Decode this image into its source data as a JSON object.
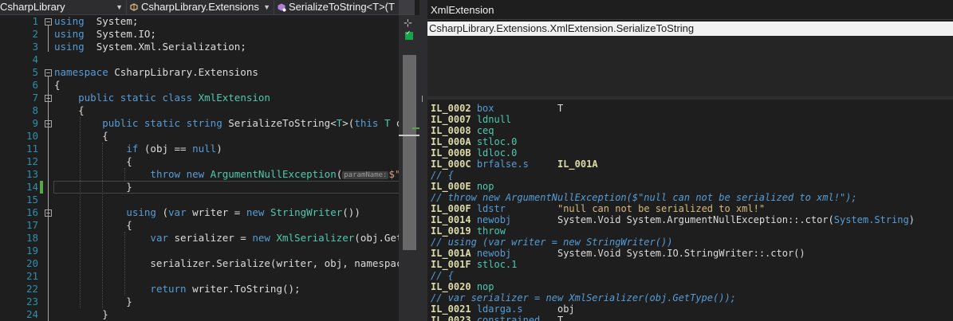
{
  "nav": {
    "project": "CsharpLibrary",
    "type": "CsharpLibrary.Extensions",
    "member": "SerializeToString<T>(T o"
  },
  "editor": {
    "line_numbers": [
      "1",
      "2",
      "3",
      "4",
      "5",
      "6",
      "7",
      "8",
      "9",
      "10",
      "11",
      "12",
      "13",
      "14",
      "15",
      "16",
      "17",
      "18",
      "19",
      "20",
      "21",
      "22",
      "23",
      "24"
    ],
    "lines": [
      [
        [
          "kw",
          "using"
        ],
        [
          "",
          "  System;"
        ]
      ],
      [
        [
          "kw",
          "using"
        ],
        [
          "",
          "  System.IO;"
        ]
      ],
      [
        [
          "kw",
          "using"
        ],
        [
          "",
          "  System.Xml.Serialization;"
        ]
      ],
      [],
      [
        [
          "kw",
          "namespace"
        ],
        [
          "",
          " CsharpLibrary.Extensions"
        ]
      ],
      [
        [
          "",
          "{"
        ]
      ],
      [
        [
          "",
          "    "
        ],
        [
          "kw",
          "public static class"
        ],
        [
          "",
          ""
        ],
        [
          "ty",
          " XmlExtension"
        ]
      ],
      [
        [
          "",
          "    {"
        ]
      ],
      [
        [
          "",
          "        "
        ],
        [
          "kw",
          "public static string"
        ],
        [
          "",
          " SerializeToString<"
        ],
        [
          "ty",
          "T"
        ],
        [
          "",
          ">("
        ],
        [
          "kw",
          "this"
        ],
        [
          "ty",
          " T"
        ],
        [
          "",
          " obj,"
        ]
      ],
      [
        [
          "",
          "        {"
        ]
      ],
      [
        [
          "",
          "            "
        ],
        [
          "kw",
          "if"
        ],
        [
          "",
          " (obj == "
        ],
        [
          "kw",
          "null"
        ],
        [
          "",
          ")"
        ]
      ],
      [
        [
          "",
          "            {"
        ]
      ],
      [
        [
          "",
          "                "
        ],
        [
          "kw",
          "throw new"
        ],
        [
          "ty",
          " ArgumentNullException"
        ],
        [
          "",
          "("
        ],
        [
          "hint",
          "paramName:"
        ],
        [
          "st",
          "$\"null"
        ]
      ],
      [
        [
          "",
          "            }"
        ]
      ],
      [],
      [
        [
          "",
          "            "
        ],
        [
          "kw",
          "using"
        ],
        [
          "",
          " ("
        ],
        [
          "kw",
          "var"
        ],
        [
          "",
          " writer = "
        ],
        [
          "kw",
          "new"
        ],
        [
          "ty",
          " StringWriter"
        ],
        [
          "",
          "()"
        ],
        [
          "",
          ")"
        ]
      ],
      [
        [
          "",
          "            {"
        ]
      ],
      [
        [
          "",
          "                "
        ],
        [
          "kw",
          "var"
        ],
        [
          "",
          " serializer = "
        ],
        [
          "kw",
          "new"
        ],
        [
          "ty",
          " XmlSerializer"
        ],
        [
          "",
          "(obj.GetType"
        ]
      ],
      [],
      [
        [
          "",
          "                serializer.Serialize(writer, obj, namespaces);"
        ]
      ],
      [],
      [
        [
          "",
          "                "
        ],
        [
          "kw",
          "return"
        ],
        [
          "",
          " writer.ToString();"
        ]
      ],
      [
        [
          "",
          "            }"
        ]
      ],
      [
        [
          "",
          "        }"
        ]
      ]
    ]
  },
  "search": {
    "value": "XmlExtension"
  },
  "results": [
    "CsharpLibrary.Extensions.XmlExtension.SerializeToString"
  ],
  "il": [
    {
      "label": "IL_0002",
      "op": "box",
      "pad": "           ",
      "arg": "T",
      "argType": "arg"
    },
    {
      "label": "IL_0007",
      "op": "ldnull",
      "opType": "op"
    },
    {
      "label": "IL_0008",
      "op": "ceq",
      "opType": "op"
    },
    {
      "label": "IL_000A",
      "op": "stloc.0",
      "opType": "op"
    },
    {
      "label": "IL_000B",
      "op": "ldloc.0",
      "opType": "op"
    },
    {
      "label": "IL_000C",
      "op": "brfalse.s",
      "pad": "     ",
      "arg": "IL_001A",
      "argType": "argl"
    },
    {
      "comment": "// {"
    },
    {
      "label": "IL_000E",
      "op": "nop",
      "opType": "op"
    },
    {
      "comment": "// throw new ArgumentNullException($\"null can not be serialized to xml!\");"
    },
    {
      "label": "IL_000F",
      "op": "ldstr",
      "pad": "         ",
      "arg": "\"null can not be serialized to xml!\"",
      "argType": "args"
    },
    {
      "label": "IL_0014",
      "op": "newobj",
      "pad": "        ",
      "arg": "System.Void System.ArgumentNullException::.ctor(",
      "argType": "arg",
      "argTail": "System.String",
      "tailEnd": ")"
    },
    {
      "label": "IL_0019",
      "op": "throw",
      "opType": "op"
    },
    {
      "comment": "// using (var writer = new StringWriter())"
    },
    {
      "label": "IL_001A",
      "op": "newobj",
      "pad": "        ",
      "arg": "System.Void System.IO.StringWriter::.ctor()",
      "argType": "arg"
    },
    {
      "label": "IL_001F",
      "op": "stloc.1",
      "opType": "op"
    },
    {
      "comment": "// {"
    },
    {
      "label": "IL_0020",
      "op": "nop",
      "opType": "op"
    },
    {
      "comment": "// var serializer = new XmlSerializer(obj.GetType());"
    },
    {
      "label": "IL_0021",
      "op": "ldarga.s",
      "pad": "      ",
      "arg": "obj",
      "argType": "arg"
    },
    {
      "label": "IL_0023",
      "op": "constrained.",
      "pad": "  ",
      "arg": "T",
      "argType": "arg"
    }
  ]
}
